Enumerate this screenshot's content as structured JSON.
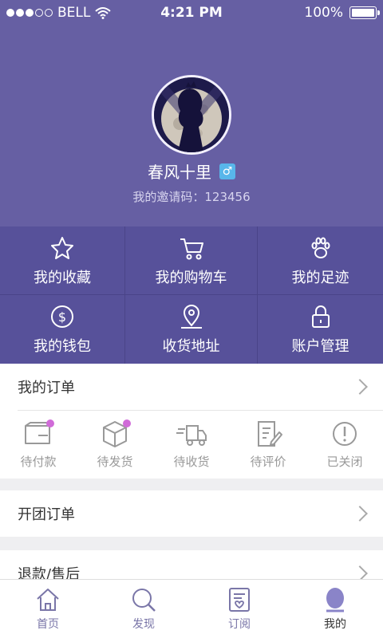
{
  "status_bar": {
    "carrier": "BELL",
    "time": "4:21 PM",
    "battery": "100%",
    "battery_level": 1.0
  },
  "profile": {
    "username": "春风十里",
    "gender_symbol": "♂",
    "invite_code": "我的邀请码：123456"
  },
  "menu": [
    {
      "label": "我的收藏",
      "icon": "star-icon"
    },
    {
      "label": "我的购物车",
      "icon": "cart-icon"
    },
    {
      "label": "我的足迹",
      "icon": "paw-icon"
    },
    {
      "label": "我的钱包",
      "icon": "dollar-icon"
    },
    {
      "label": "收货地址",
      "icon": "location-icon"
    },
    {
      "label": "账户管理",
      "icon": "lock-icon"
    }
  ],
  "orders": {
    "title": "我的订单",
    "statuses": [
      {
        "label": "待付款",
        "icon": "wallet-icon",
        "badge": true
      },
      {
        "label": "待发货",
        "icon": "box-icon",
        "badge": true
      },
      {
        "label": "待收货",
        "icon": "truck-icon",
        "badge": false
      },
      {
        "label": "待评价",
        "icon": "edit-icon",
        "badge": false
      },
      {
        "label": "已关闭",
        "icon": "alert-icon",
        "badge": false
      }
    ]
  },
  "group_orders": {
    "title": "开团订单"
  },
  "refunds": {
    "title": "退款/售后"
  },
  "tabbar": [
    {
      "label": "首页",
      "icon": "home-icon"
    },
    {
      "label": "发现",
      "icon": "search-icon"
    },
    {
      "label": "订阅",
      "icon": "subscribe-icon"
    },
    {
      "label": "我的",
      "icon": "profile-icon",
      "active": true
    }
  ],
  "colors": {
    "header": "#665fa3",
    "grid": "#57519a",
    "accent": "#7a76a8",
    "badge": "#d06bd8"
  }
}
